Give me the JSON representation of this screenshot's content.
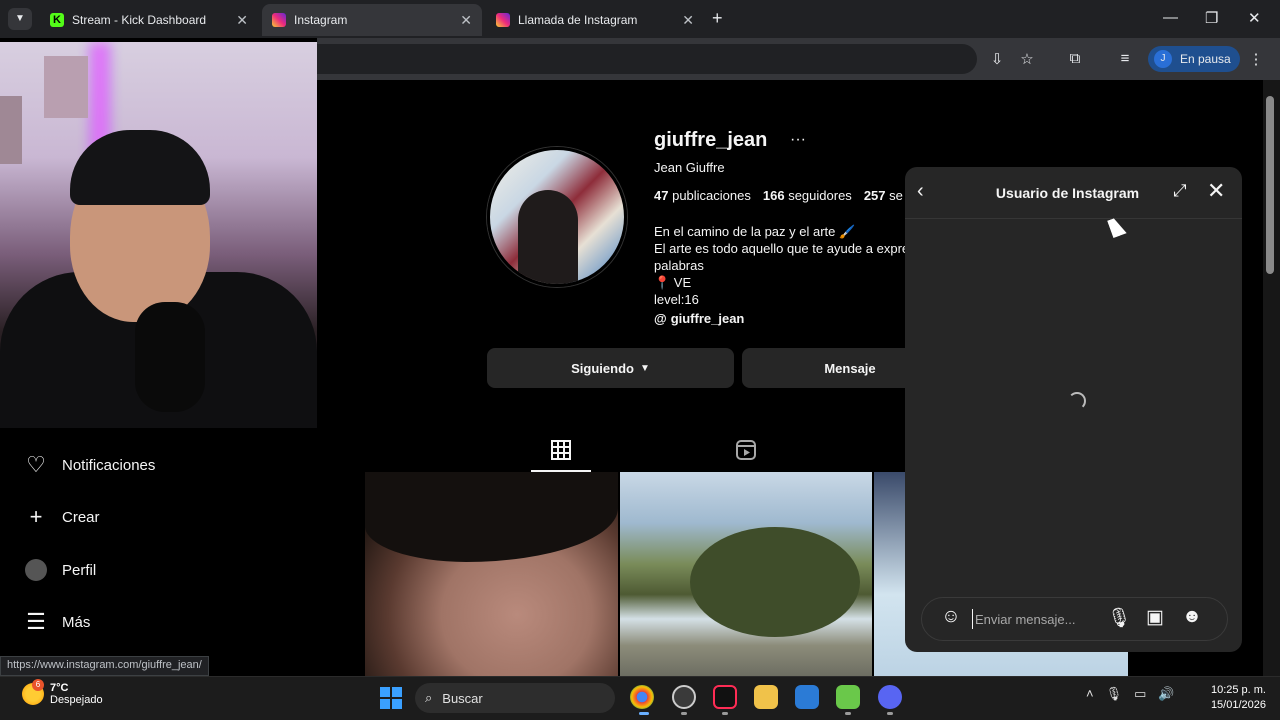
{
  "browser": {
    "tabs": [
      {
        "title": "Stream - Kick Dashboard",
        "active": false
      },
      {
        "title": "Instagram",
        "active": true
      },
      {
        "title": "Llamada de Instagram",
        "active": false
      }
    ],
    "profile_label": "En pausa",
    "profile_initial": "J",
    "status_url": "https://www.instagram.com/giuffre_jean/"
  },
  "sidebar": {
    "items": [
      {
        "label": "Notificaciones",
        "icon": "heart-icon"
      },
      {
        "label": "Crear",
        "icon": "plus-icon"
      },
      {
        "label": "Perfil",
        "icon": "profile-avatar"
      },
      {
        "label": "Más",
        "icon": "menu-icon"
      }
    ]
  },
  "profile": {
    "username": "giuffre_jean",
    "full_name": "Jean Giuffre",
    "posts": "47",
    "posts_label": "publicaciones",
    "followers": "166",
    "followers_label": "seguidores",
    "following": "257",
    "following_label": "se",
    "bio_lines": [
      "En el camino de la paz y el arte 🖌️",
      "El arte es todo aquello que te ayude a expre",
      "palabras",
      "📍 VE",
      "level:16"
    ],
    "threads_handle": "giuffre_jean",
    "following_button": "Siguiendo",
    "message_button": "Mensaje"
  },
  "chat": {
    "title": "Usuario de Instagram",
    "input_placeholder": "Enviar mensaje..."
  },
  "taskbar": {
    "weather_temp": "7°C",
    "weather_desc": "Despejado",
    "weather_badge": "6",
    "search_label": "Buscar",
    "time": "10:25 p. m.",
    "date": "15/01/2026"
  },
  "colors": {
    "instagram_bg": "#000000",
    "chat_bg": "#262626",
    "button_bg": "#262626",
    "chrome_profile": "#1f4f8f"
  }
}
